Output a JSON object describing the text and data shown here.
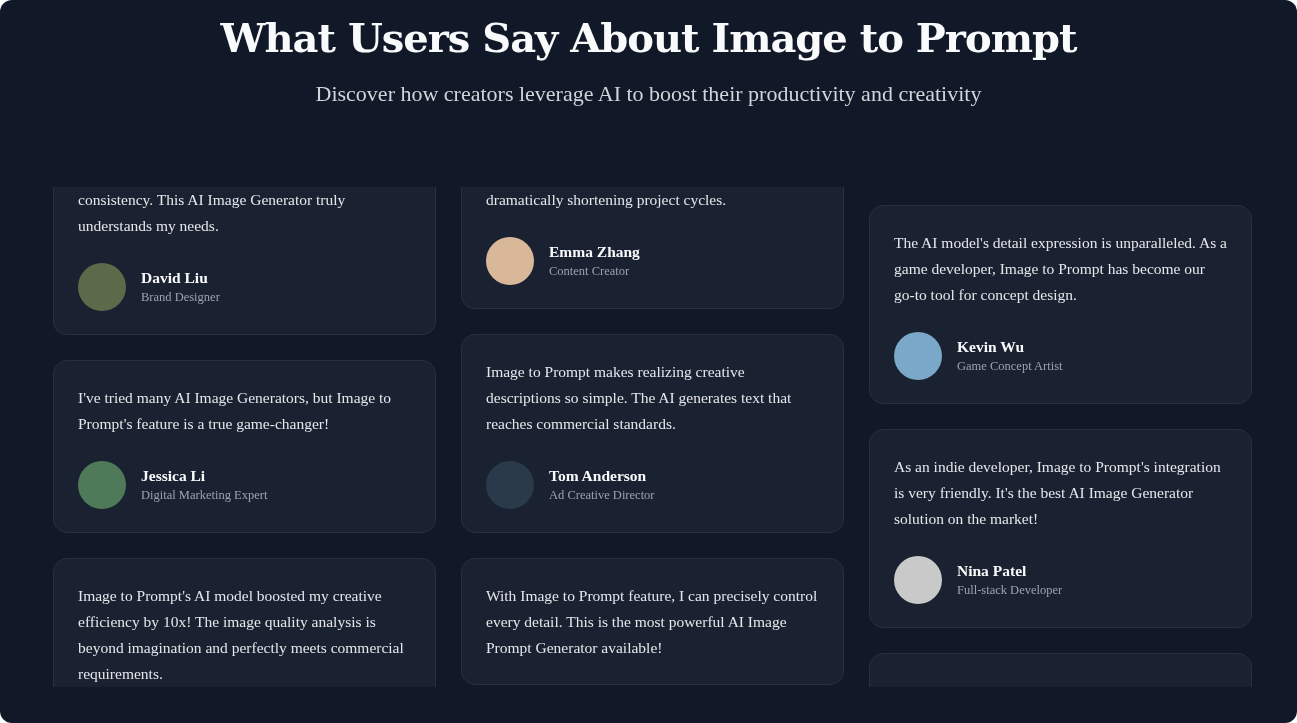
{
  "header": {
    "title": "What Users Say About Image to Prompt",
    "subtitle": "Discover how creators leverage AI to boost their productivity and creativity"
  },
  "columns": [
    {
      "testimonials": [
        {
          "quote": "consistency. This AI Image Generator truly understands my needs.",
          "name": "David Liu",
          "role": "Brand Designer",
          "cut_top": true
        },
        {
          "quote": "I've tried many AI Image Generators, but Image to Prompt's feature is a true game-changer!",
          "name": "Jessica Li",
          "role": "Digital Marketing Expert",
          "cut_top": false
        },
        {
          "quote": "Image to Prompt's AI model boosted my creative efficiency by 10x! The image quality analysis is beyond imagination and perfectly meets commercial requirements.",
          "cut_top": false
        }
      ]
    },
    {
      "testimonials": [
        {
          "quote": "dramatically shortening project cycles.",
          "name": "Emma Zhang",
          "role": "Content Creator",
          "cut_top": true
        },
        {
          "quote": "Image to Prompt makes realizing creative descriptions so simple. The AI generates text that reaches commercial standards.",
          "name": "Tom Anderson",
          "role": "Ad Creative Director",
          "cut_top": false
        },
        {
          "quote": "With Image to Prompt feature, I can precisely control every detail. This is the most powerful AI Image Prompt Generator available!",
          "cut_top": false
        }
      ]
    },
    {
      "testimonials": [
        {
          "quote": "The AI model's detail expression is unparalleled. As a game developer, Image to Prompt has become our go-to tool for concept design.",
          "name": "Kevin Wu",
          "role": "Game Concept Artist",
          "cut_top": false
        },
        {
          "quote": "As an indie developer, Image to Prompt's integration is very friendly. It's the best AI Image Generator solution on the market!",
          "name": "Nina Patel",
          "role": "Full-stack Developer",
          "cut_top": false
        },
        {
          "cut_top": false
        }
      ]
    }
  ]
}
